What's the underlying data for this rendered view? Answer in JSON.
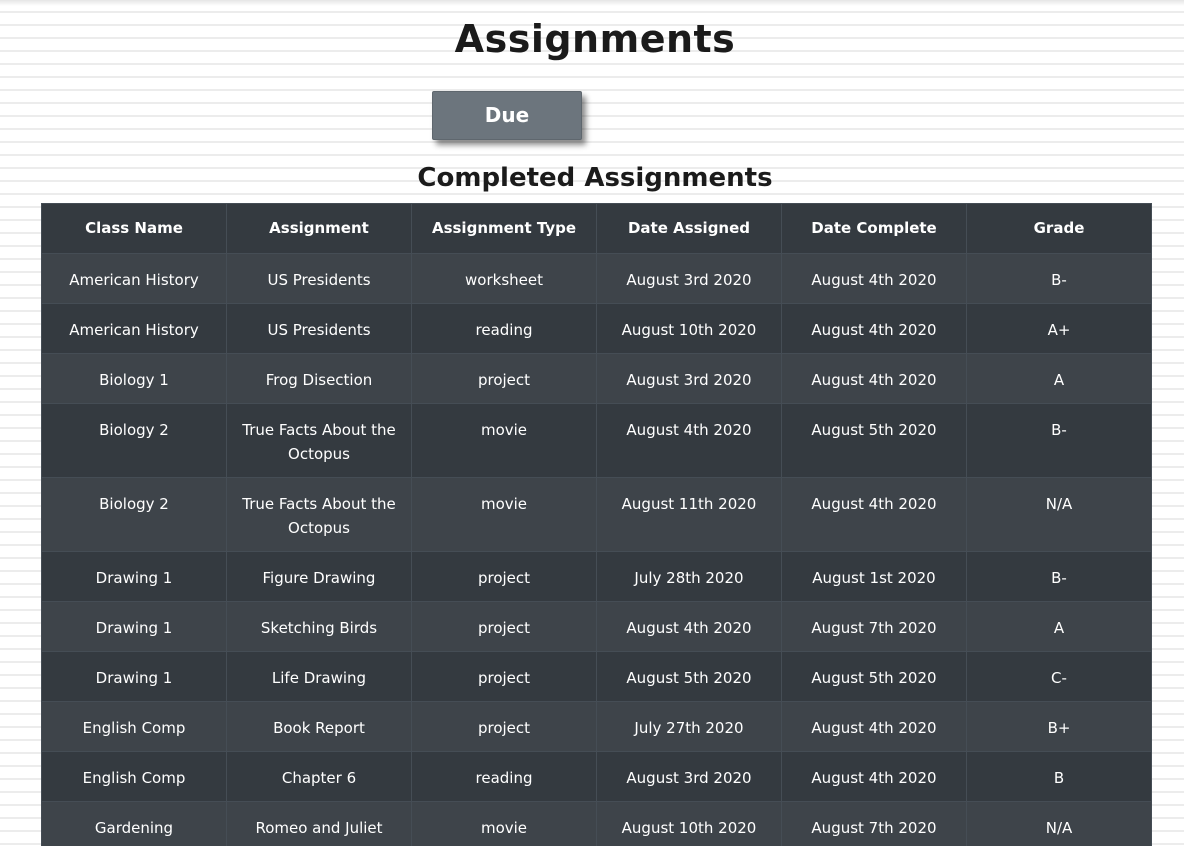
{
  "page": {
    "title": "Assignments",
    "due_button_label": "Due",
    "section_title": "Completed Assignments"
  },
  "table": {
    "headers": [
      "Class Name",
      "Assignment",
      "Assignment Type",
      "Date Assigned",
      "Date Complete",
      "Grade"
    ],
    "rows": [
      [
        "American History",
        "US Presidents",
        "worksheet",
        "August 3rd 2020",
        "August 4th 2020",
        "B-"
      ],
      [
        "American History",
        "US Presidents",
        "reading",
        "August 10th 2020",
        "August 4th 2020",
        "A+"
      ],
      [
        "Biology 1",
        "Frog Disection",
        "project",
        "August 3rd 2020",
        "August 4th 2020",
        "A"
      ],
      [
        "Biology 2",
        "True Facts About the Octopus",
        "movie",
        "August 4th 2020",
        "August 5th 2020",
        "B-"
      ],
      [
        "Biology 2",
        "True Facts About the Octopus",
        "movie",
        "August 11th 2020",
        "August 4th 2020",
        "N/A"
      ],
      [
        "Drawing 1",
        "Figure Drawing",
        "project",
        "July 28th 2020",
        "August 1st 2020",
        "B-"
      ],
      [
        "Drawing 1",
        "Sketching Birds",
        "project",
        "August 4th 2020",
        "August 7th 2020",
        "A"
      ],
      [
        "Drawing 1",
        "Life Drawing",
        "project",
        "August 5th 2020",
        "August 5th 2020",
        "C-"
      ],
      [
        "English Comp",
        "Book Report",
        "project",
        "July 27th 2020",
        "August 4th 2020",
        "B+"
      ],
      [
        "English Comp",
        "Chapter 6",
        "reading",
        "August 3rd 2020",
        "August 4th 2020",
        "B"
      ],
      [
        "Gardening",
        "Romeo and Juliet",
        "movie",
        "August 10th 2020",
        "August 7th 2020",
        "N/A"
      ]
    ]
  },
  "colors": {
    "table_dark": "#343a40",
    "table_stripe": "#3e444a",
    "button_gray": "#6c757d"
  }
}
